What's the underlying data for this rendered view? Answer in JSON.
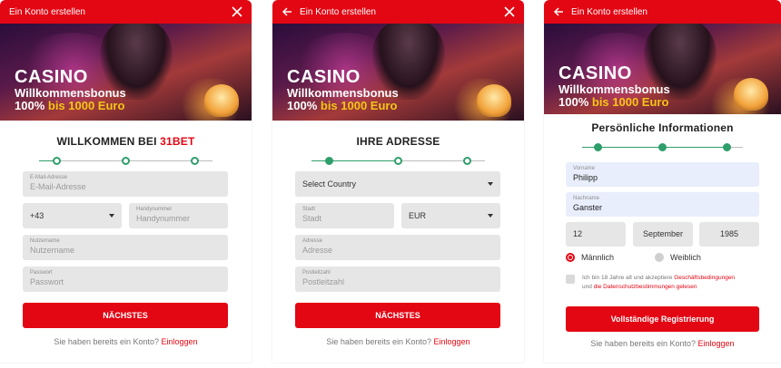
{
  "colors": {
    "brand": "#e30613",
    "progress": "#2e9e6a",
    "gold": "#f5c518"
  },
  "banner": {
    "line1": "CASINO",
    "line2": "Willkommensbonus",
    "line3a": "100%",
    "line3b": "bis 1000 Euro"
  },
  "panel1": {
    "header_title": "Ein Konto erstellen",
    "close_icon": "close-icon",
    "step_title": "WILLKOMMEN BEI",
    "step_brand": "31BET",
    "progress_value": 0.0,
    "email": {
      "label": "E-Mail-Adresse",
      "placeholder": "E-Mail-Adresse"
    },
    "country_code": "+43",
    "phone": {
      "label": "Handynummer",
      "placeholder": "Handynummer"
    },
    "username": {
      "label": "Nutzername",
      "placeholder": "Nutzername"
    },
    "password": {
      "label": "Passwort",
      "placeholder": "Passwort"
    },
    "next_button": "NÄCHSTES",
    "footer_text": "Sie haben bereits ein Konto?",
    "footer_link": "Einloggen"
  },
  "panel2": {
    "header_title": "Ein Konto erstellen",
    "back_icon": "arrow-left-icon",
    "close_icon": "close-icon",
    "step_title": "IHRE ADRESSE",
    "progress_value": 0.5,
    "country_select": "Select Country",
    "city": {
      "label": "Stadt",
      "placeholder": "Stadt"
    },
    "currency_select": "EUR",
    "address": {
      "label": "Adresse",
      "placeholder": "Adresse"
    },
    "zip": {
      "label": "Postleitzahl",
      "placeholder": "Postleitzahl"
    },
    "next_button": "NÄCHSTES",
    "footer_text": "Sie haben bereits ein Konto?",
    "footer_link": "Einloggen"
  },
  "panel3": {
    "header_title": "Ein Konto erstellen",
    "back_icon": "arrow-left-icon",
    "step_title": "Persönliche Informationen",
    "progress_value": 1.0,
    "firstname": {
      "label": "Vorname",
      "value": "Philipp"
    },
    "lastname": {
      "label": "Nachname",
      "value": "Ganster"
    },
    "birth_day": "12",
    "birth_month": "September",
    "birth_year": "1985",
    "gender_male": "Männlich",
    "gender_female": "Weiblich",
    "gender_selected": "Männlich",
    "terms_text1": "Ich bin 18 Jahre alt und akzeptiere",
    "terms_link1": "Geschäftsbedingungen",
    "terms_text2": "und",
    "terms_link2": "die Datenschutzbestimmungen gelesen",
    "terms_checked": false,
    "register_button": "Vollständige Registrierung",
    "footer_text": "Sie haben bereits ein Konto?",
    "footer_link": "Einloggen"
  }
}
